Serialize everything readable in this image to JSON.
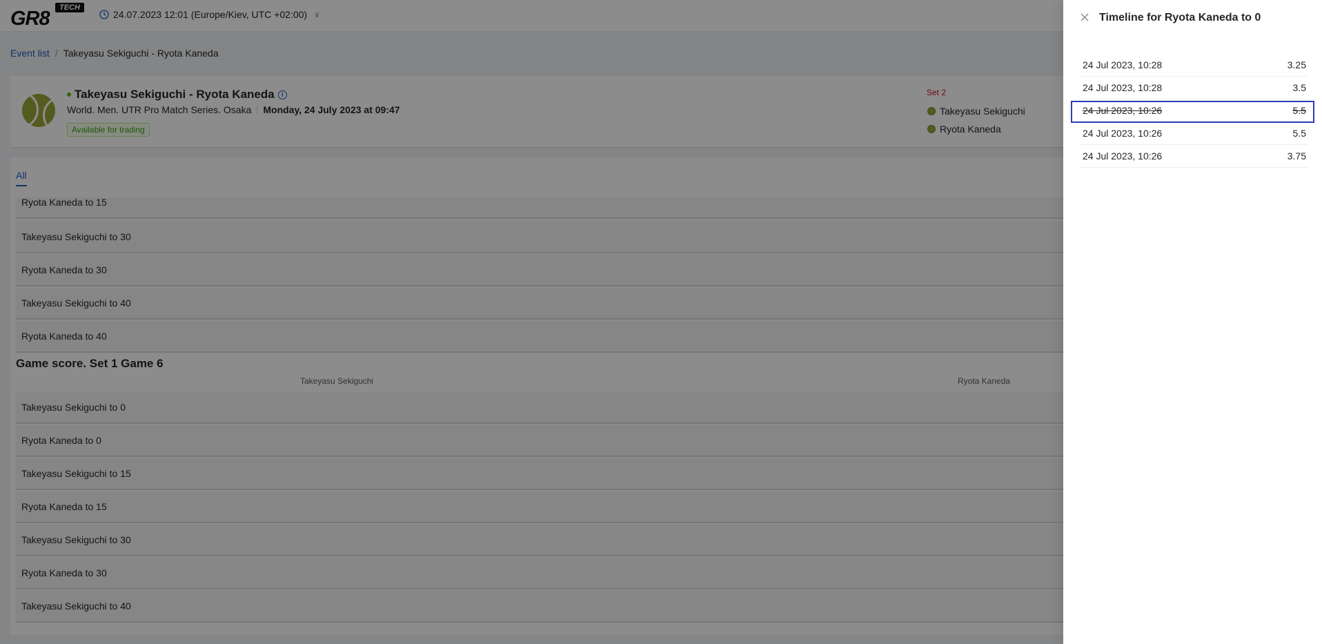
{
  "header": {
    "logo_text": "GR8",
    "logo_badge": "TECH",
    "datetime": "24.07.2023 12:01 (Europe/Kiev, UTC +02:00)"
  },
  "breadcrumb": {
    "root": "Event list",
    "separator": "/",
    "current": "Takeyasu Sekiguchi - Ryota Kaneda"
  },
  "event": {
    "title": "Takeyasu Sekiguchi - Ryota Kaneda",
    "competition": "World. Men. UTR Pro Match Series. Osaka",
    "start": "Monday, 24 July 2023 at 09:47",
    "status": "Available for trading",
    "set_label": "Set 2",
    "player1": "Takeyasu Sekiguchi",
    "player2": "Ryota Kaneda"
  },
  "tabs": {
    "all": "All"
  },
  "markets_top": [
    "Ryota Kaneda to 15",
    "Takeyasu Sekiguchi to 30",
    "Ryota Kaneda to 30",
    "Takeyasu Sekiguchi to 40",
    "Ryota Kaneda to 40"
  ],
  "group": {
    "title": "Game score. Set 1 Game 6",
    "col1": "Takeyasu Sekiguchi",
    "col2": "Ryota Kaneda",
    "markets": [
      "Takeyasu Sekiguchi to 0",
      "Ryota Kaneda to 0",
      "Takeyasu Sekiguchi to 15",
      "Ryota Kaneda to 15",
      "Takeyasu Sekiguchi to 30",
      "Ryota Kaneda to 30",
      "Takeyasu Sekiguchi to 40"
    ]
  },
  "drawer": {
    "title": "Timeline for Ryota Kaneda to 0",
    "timeline": [
      {
        "time": "24 Jul 2023, 10:28",
        "odds": "3.25",
        "struck": false
      },
      {
        "time": "24 Jul 2023, 10:28",
        "odds": "3.5",
        "struck": false
      },
      {
        "time": "24 Jul 2023, 10:26",
        "odds": "5.5",
        "struck": true
      },
      {
        "time": "24 Jul 2023, 10:26",
        "odds": "5.5",
        "struck": false
      },
      {
        "time": "24 Jul 2023, 10:26",
        "odds": "3.75",
        "struck": false
      }
    ]
  }
}
